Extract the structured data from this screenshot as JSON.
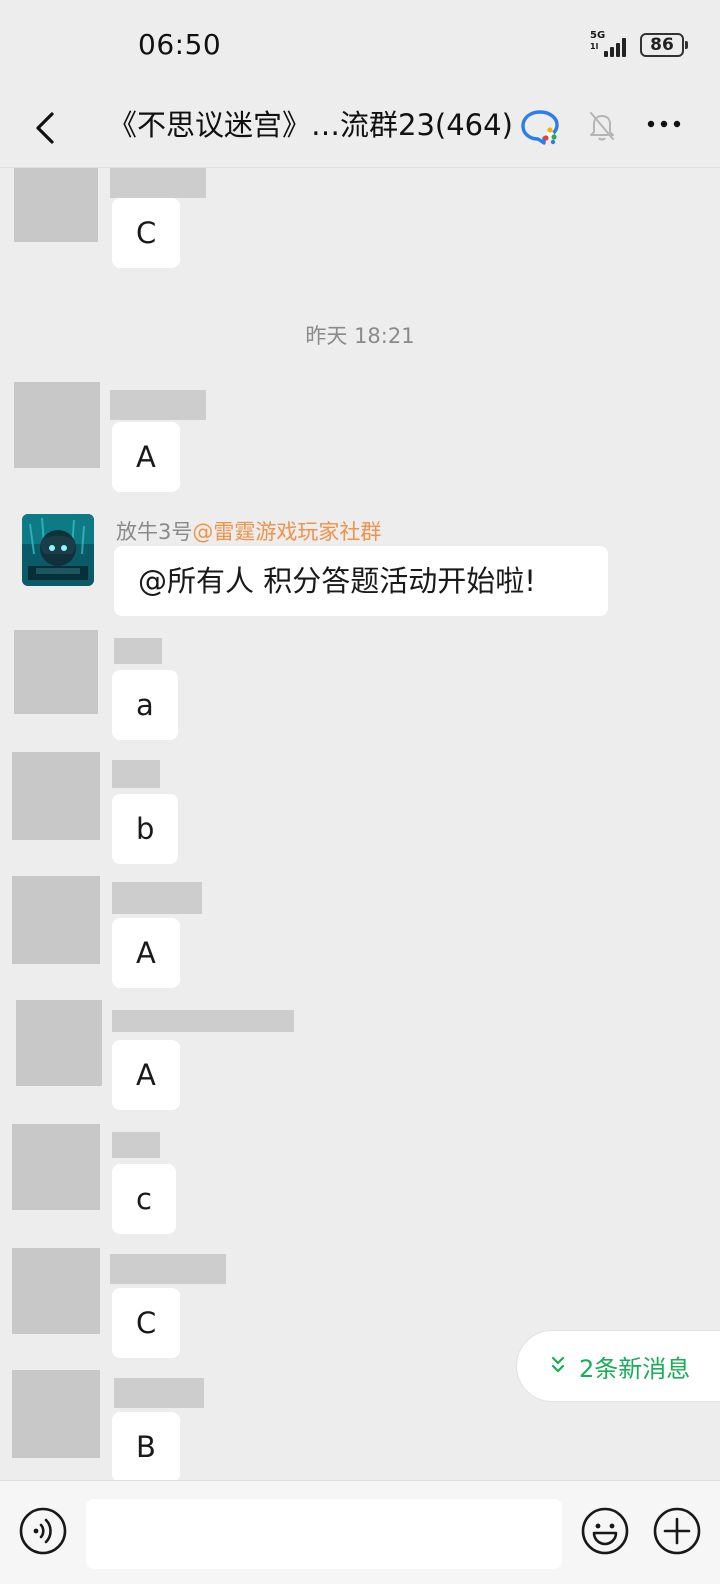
{
  "status_bar": {
    "time": "06:50",
    "network": "5G",
    "network_sub": "1l",
    "battery": "86"
  },
  "header": {
    "title": "《不思议迷宫》…流群23(464)",
    "icons": [
      "back-icon",
      "qq-icon",
      "bell-off-icon",
      "more-icon"
    ]
  },
  "chat": {
    "timestamp": "昨天 18:21",
    "messages": [
      {
        "text": "C"
      },
      {
        "text": "A"
      },
      {
        "sender": "放牛3号",
        "sender_tag": "@雷霆游戏玩家社群",
        "text": "@所有人 积分答题活动开始啦!"
      },
      {
        "text": "a"
      },
      {
        "text": "b"
      },
      {
        "text": "A"
      },
      {
        "text": "A"
      },
      {
        "text": "c"
      },
      {
        "text": "C"
      },
      {
        "text": "B"
      }
    ]
  },
  "new_messages": {
    "label": "2条新消息",
    "color": "#1aad58"
  },
  "input_bar": {
    "value": "",
    "icons": [
      "voice-icon",
      "emoji-icon",
      "plus-icon"
    ]
  },
  "colors": {
    "background": "#ededed",
    "bubble": "#ffffff",
    "sender_tag": "#f0924a",
    "name": "#8a8a8a"
  }
}
